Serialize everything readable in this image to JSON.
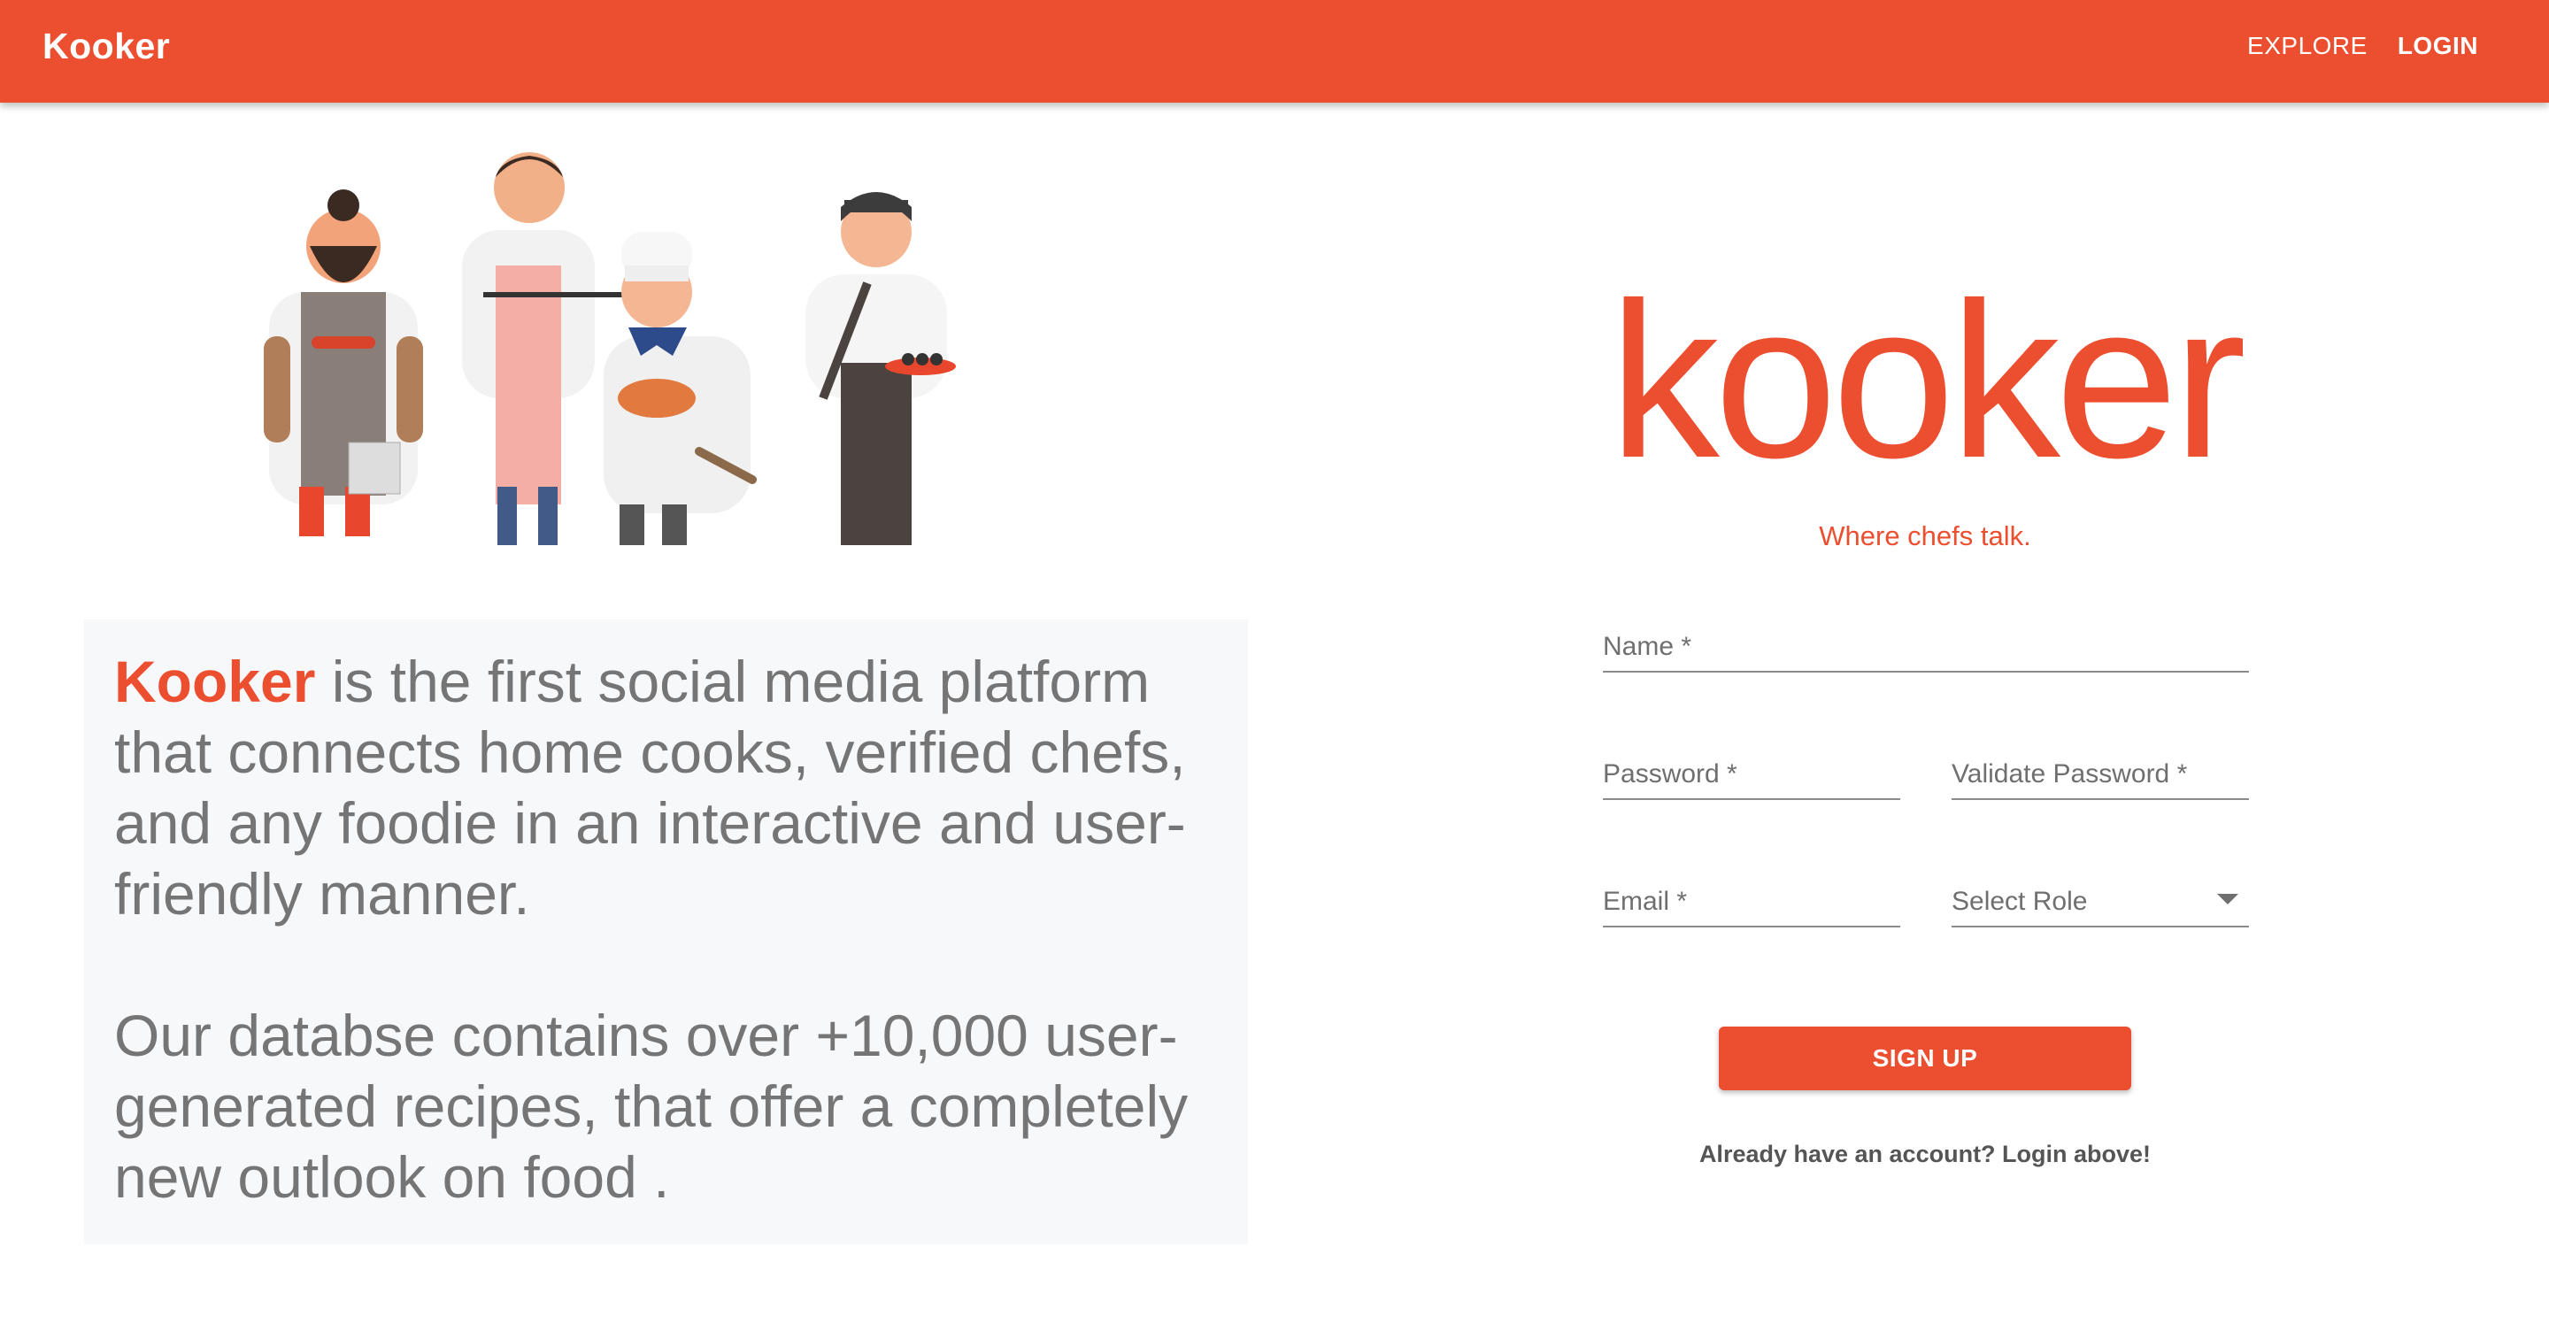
{
  "appbar": {
    "brand": "Kooker",
    "nav": {
      "explore": "EXPLORE",
      "login": "LOGIN"
    },
    "color": "#ec4f2f"
  },
  "illustration": {
    "chefs": [
      "bearded-griller",
      "waiter-with-tray",
      "baker-chef",
      "sushi-chef"
    ]
  },
  "pitch": {
    "brand_word": "Kooker",
    "paragraph1_rest": " is the first social media platform that connects home cooks, verified chefs, and any foodie in an interactive and user-friendly manner.",
    "paragraph2": "Our databse contains over +10,000 user-generated recipes, that offer a completely new outlook on food ."
  },
  "logo": {
    "word": "kooker",
    "tagline": "Where chefs talk."
  },
  "form": {
    "name_label": "Name *",
    "password_label": "Password *",
    "validate_password_label": "Validate Password *",
    "email_label": "Email *",
    "role_label": "Select Role",
    "signup_label": "SIGN UP",
    "login_hint": "Already have an account? Login above!"
  }
}
